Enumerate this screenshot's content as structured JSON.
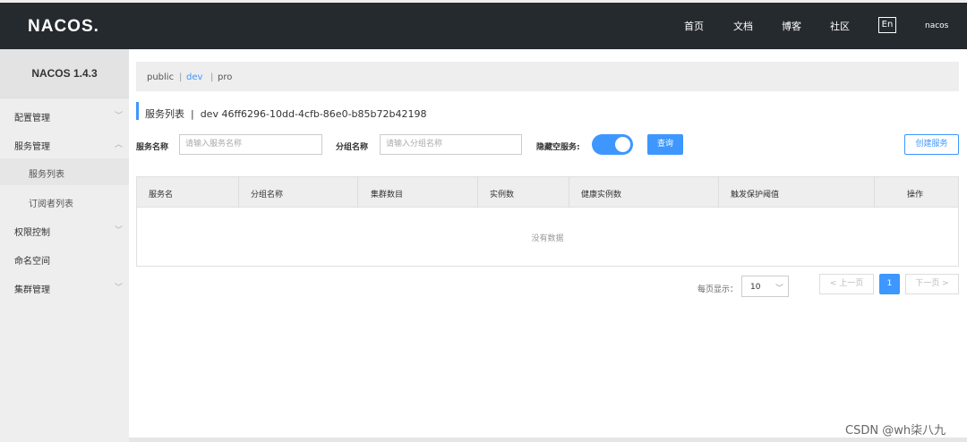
{
  "header": {
    "logo": "NACOS.",
    "nav": [
      "首页",
      "文档",
      "博客",
      "社区"
    ],
    "lang": "En",
    "user": "nacos"
  },
  "sidebar": {
    "title": "NACOS 1.4.3",
    "items": [
      {
        "label": "配置管理"
      },
      {
        "label": "服务管理"
      },
      {
        "label": "服务列表"
      },
      {
        "label": "订阅者列表"
      },
      {
        "label": "权限控制"
      },
      {
        "label": "命名空间"
      },
      {
        "label": "集群管理"
      }
    ]
  },
  "namespaces": {
    "items": [
      "public",
      "dev",
      "pro"
    ],
    "active": "dev"
  },
  "page": {
    "title": "服务列表",
    "namespace": "dev",
    "namespace_id": "46ff6296-10dd-4cfb-86e0-b85b72b42198"
  },
  "filters": {
    "service_name_label": "服务名称",
    "service_name_placeholder": "请输入服务名称",
    "group_name_label": "分组名称",
    "group_name_placeholder": "请输入分组名称",
    "hide_empty_label": "隐藏空服务:",
    "query_button": "查询",
    "create_button": "创建服务"
  },
  "table": {
    "columns": [
      "服务名",
      "分组名称",
      "集群数目",
      "实例数",
      "健康实例数",
      "触发保护阈值",
      "操作"
    ],
    "empty_text": "没有数据"
  },
  "pagination": {
    "page_size_label": "每页显示：",
    "page_size": "10",
    "prev": "< 上一页",
    "current": "1",
    "next": "下一页 >"
  },
  "watermark": "CSDN @wh柒八九",
  "colors": {
    "header_bg": "#252a2f",
    "accent": "#3d97ff",
    "sidebar_bg": "#eeeeee"
  }
}
